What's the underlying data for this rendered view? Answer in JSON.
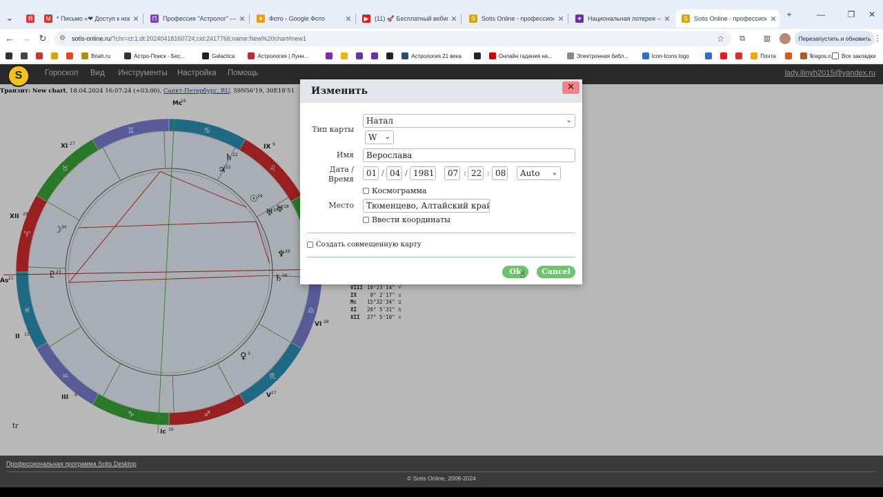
{
  "browser": {
    "tabs": [
      {
        "title": "* Письмо «❤ Доступ к нове",
        "color": "#d93025",
        "glyph": "M"
      },
      {
        "title": "Профессия \"Астролог\" — Tel",
        "color": "#7b3fbf",
        "glyph": "П"
      },
      {
        "title": "Фото - Google Фото",
        "color": "#e8a10c",
        "glyph": "✦"
      },
      {
        "title": "(11) 🚀 Бесплатный вебинар",
        "color": "#e01b1b",
        "glyph": "▶"
      },
      {
        "title": "Sotis Online - профессиональ",
        "color": "#d9a400",
        "glyph": "S"
      },
      {
        "title": "Национальная лотерея — ку",
        "color": "#6b2fa8",
        "glyph": "✦"
      },
      {
        "title": "Sotis Online - профессиональ",
        "color": "#d9a400",
        "glyph": "S"
      }
    ],
    "active_tab": 6,
    "url_host": "sotis-online.ru",
    "url_path": "/?chr=ct:1;dt:20240418160724;cid:2417766;name:New%20chart#new1",
    "relaunch_label": "Перезапустить и обновить",
    "bookmarks": [
      {
        "label": "",
        "color": "#333"
      },
      {
        "label": "",
        "color": "#444"
      },
      {
        "label": "",
        "color": "#c33"
      },
      {
        "label": "",
        "color": "#d9a400"
      },
      {
        "label": "",
        "color": "#e04a1a"
      },
      {
        "label": "Briah.ru",
        "color": "#b58b00"
      },
      {
        "label": "Астро-Поиск - Бес...",
        "color": "#333"
      },
      {
        "label": "Galactica",
        "color": "#222"
      },
      {
        "label": "Астрология | Лунн...",
        "color": "#c2272d"
      },
      {
        "label": "",
        "color": "#7a2bbf"
      },
      {
        "label": "",
        "color": "#f0b400"
      },
      {
        "label": "",
        "color": "#6b2fa8"
      },
      {
        "label": "",
        "color": "#6b2fa8"
      },
      {
        "label": "",
        "color": "#222"
      },
      {
        "label": "Астрология 21 века",
        "color": "#2a4a7a"
      },
      {
        "label": "",
        "color": "#222"
      },
      {
        "label": "Онлайн гадания на...",
        "color": "#c00"
      },
      {
        "label": "Электронная библ...",
        "color": "#888"
      },
      {
        "label": "Icon-Icons logo",
        "color": "#2a6fd1"
      },
      {
        "label": "",
        "color": "#2c6ad6"
      },
      {
        "label": "",
        "color": "#e01b1b"
      },
      {
        "label": "",
        "color": "#d93025"
      },
      {
        "label": "Почта",
        "color": "#f1a900"
      },
      {
        "label": "",
        "color": "#d05a1a"
      },
      {
        "label": "Tragos.ru",
        "color": "#b05a2a"
      }
    ],
    "all_bookmarks_label": "Все закладки"
  },
  "site": {
    "menu": [
      "Гороскоп",
      "Вид",
      "Инструменты",
      "Настройка",
      "Помощь"
    ],
    "user": "lady.ilinyh2015@yandex.ru",
    "transit_prefix": "Транзит:",
    "transit_name": "New chart",
    "transit_datetime": ", 18.04.2024 16:07:24 (+03:00), ",
    "transit_place": "Санкт-Петербург, RU",
    "transit_coords": ", 59N56'19, 30E18'51",
    "tr_label": "tr",
    "footer_link": "Профессиональная программа Sotis Desktop",
    "footer_copy": "© Sotis Online, 2008-2024"
  },
  "chart": {
    "axis_labels": [
      {
        "text": "Mc",
        "deg": "16"
      },
      {
        "text": "As",
        "deg": "21"
      },
      {
        "text": "Ic",
        "deg": "16"
      }
    ],
    "house_labels": [
      {
        "roman": "XI",
        "deg": "27"
      },
      {
        "roman": "IX",
        "deg": "9"
      },
      {
        "roman": "XII",
        "deg": "28"
      },
      {
        "roman": "II",
        "deg": "11"
      },
      {
        "roman": "III",
        "deg": "9"
      },
      {
        "roman": "V",
        "deg": "27"
      },
      {
        "roman": "VI",
        "deg": "28"
      }
    ],
    "zodiac_signs": [
      "♊",
      "♋",
      "♌",
      "♍",
      "♎",
      "♏",
      "♐",
      "♑",
      "♒",
      "♓",
      "♈",
      "♉"
    ],
    "zodiac_colors": [
      "#7b7fd1",
      "#2a93b8",
      "#d42d2d",
      "#3aa83a",
      "#7b7fd1",
      "#2a93b8",
      "#d42d2d",
      "#3aa83a",
      "#7b7fd1",
      "#2a93b8",
      "#d42d2d",
      "#3aa83a"
    ],
    "planets": [
      {
        "glyph": "♃",
        "deg": "22"
      },
      {
        "glyph": "♄",
        "deg": "22"
      },
      {
        "glyph": "☉",
        "deg": "29"
      },
      {
        "glyph": "♅",
        "deg": "20"
      },
      {
        "glyph": "♅",
        "deg": "18"
      },
      {
        "glyph": "☽",
        "deg": "30"
      },
      {
        "glyph": "♆",
        "deg": "29"
      },
      {
        "glyph": "♇",
        "deg": "23"
      },
      {
        "glyph": "♄",
        "deg": "16"
      },
      {
        "glyph": "♀",
        "deg": "3"
      }
    ]
  },
  "cusp_table": [
    {
      "house": "VIII",
      "value": "10°23'14\" ♈"
    },
    {
      "house": "IX",
      "value": " 8° 2'17\" ♉"
    },
    {
      "house": "Mc",
      "value": "15°32'34\" ♊"
    },
    {
      "house": "XI",
      "value": "26° 5'31\" ♋"
    },
    {
      "house": "XII",
      "value": "27° 5'10\" ♌"
    }
  ],
  "dialog": {
    "title": "Изменить",
    "close_glyph": "✕",
    "chart_type_label": "Тип карты",
    "chart_type_value": "Натал",
    "house_system_value": "W",
    "name_label": "Имя",
    "name_value": "Верослава",
    "datetime_label_1": "Дата /",
    "datetime_label_2": "Время",
    "day": "01",
    "month": "04",
    "year": "1981",
    "hour": "07",
    "minute": "22",
    "second": "08",
    "date_sep": "/",
    "time_sep": ":",
    "timezone_value": "Auto",
    "cosmogram_label": "Космограмма",
    "place_label": "Место",
    "place_value": "Тюменцево, Алтайский край,",
    "enter_coords_label": "Ввести координаты",
    "combined_chart_label": "Создать совмещенную карту",
    "ok_label": "Ok",
    "cancel_label": "Cancel"
  }
}
